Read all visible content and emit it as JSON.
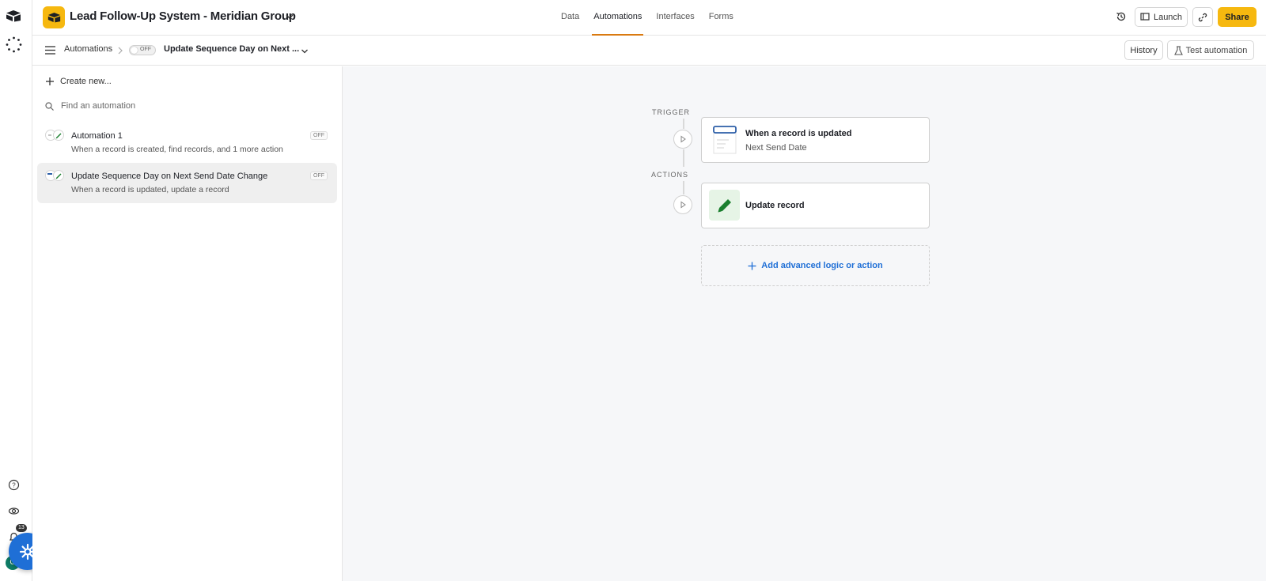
{
  "header": {
    "base_name": "Lead Follow-Up System - Meridian Group",
    "tabs": [
      {
        "label": "Data",
        "active": false
      },
      {
        "label": "Automations",
        "active": true
      },
      {
        "label": "Interfaces",
        "active": false
      },
      {
        "label": "Forms",
        "active": false
      }
    ],
    "launch_label": "Launch",
    "share_label": "Share",
    "brand_color": "#f6b80f",
    "accent_color": "#d97a10"
  },
  "subheader": {
    "breadcrumb": "Automations",
    "toggle_state": "OFF",
    "automation_title": "Update Sequence Day on Next ...",
    "history_label": "History",
    "test_label": "Test automation"
  },
  "sidebar": {
    "create_label": "Create new...",
    "search_placeholder": "Find an automation",
    "items": [
      {
        "name": "Automation 1",
        "desc": "When a record is created, find records, and 1 more action",
        "status": "OFF",
        "selected": false
      },
      {
        "name": "Update Sequence Day on Next Send Date Change",
        "desc": "When a record is updated, update a record",
        "status": "OFF",
        "selected": true
      }
    ]
  },
  "canvas": {
    "trigger_label": "TRIGGER",
    "actions_label": "ACTIONS",
    "trigger": {
      "title": "When a record is updated",
      "subtitle": "Next Send Date",
      "icon": "table-record-icon"
    },
    "action": {
      "title": "Update record",
      "icon": "pencil-icon"
    },
    "add_label": "Add advanced logic or action",
    "link_color": "#1f6fd6"
  },
  "rail": {
    "notification_count": "13",
    "avatar_initial": "C"
  }
}
